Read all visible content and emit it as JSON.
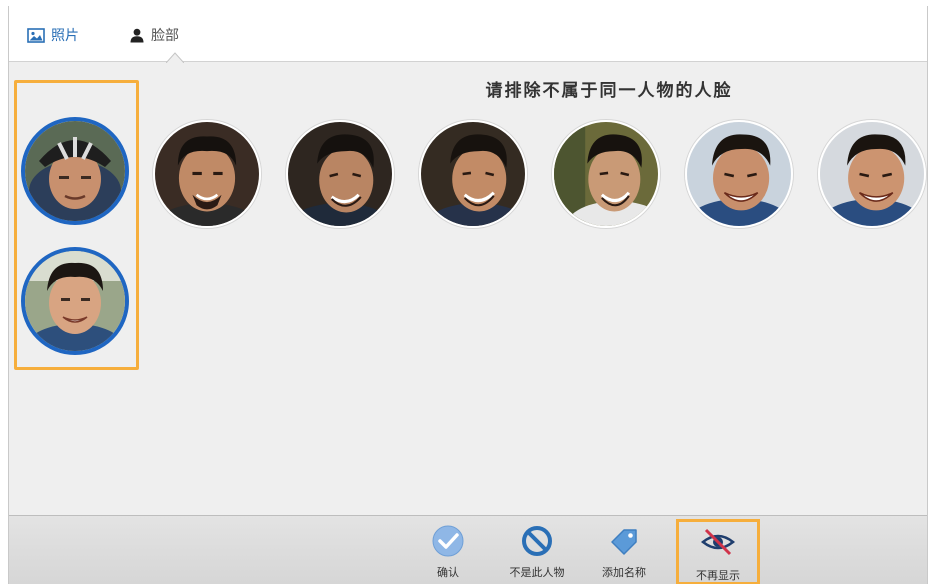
{
  "tabs": {
    "photos_label": "照片",
    "faces_label": "脸部",
    "active": "faces"
  },
  "main": {
    "instruction": "请排除不属于同一人物的人脸"
  },
  "faces": {
    "selected_count": 2,
    "total_count": 8
  },
  "toolbar": {
    "confirm_label": "确认",
    "not_this_person_label": "不是此人物",
    "add_name_label": "添加名称",
    "dont_show_again_label": "不再显示"
  },
  "colors": {
    "accent": "#1f66c2",
    "highlight": "#f6ae3c",
    "confirm_icon": "#8fb7e6",
    "block_icon": "#2a6fb6",
    "hide_slash": "#d0334a"
  },
  "icons": {
    "photos_tab": "photo-icon",
    "faces_tab": "person-icon",
    "confirm": "checkmark-icon",
    "not_this_person": "block-icon",
    "add_name": "tag-icon",
    "dont_show_again": "eye-slash-icon"
  }
}
